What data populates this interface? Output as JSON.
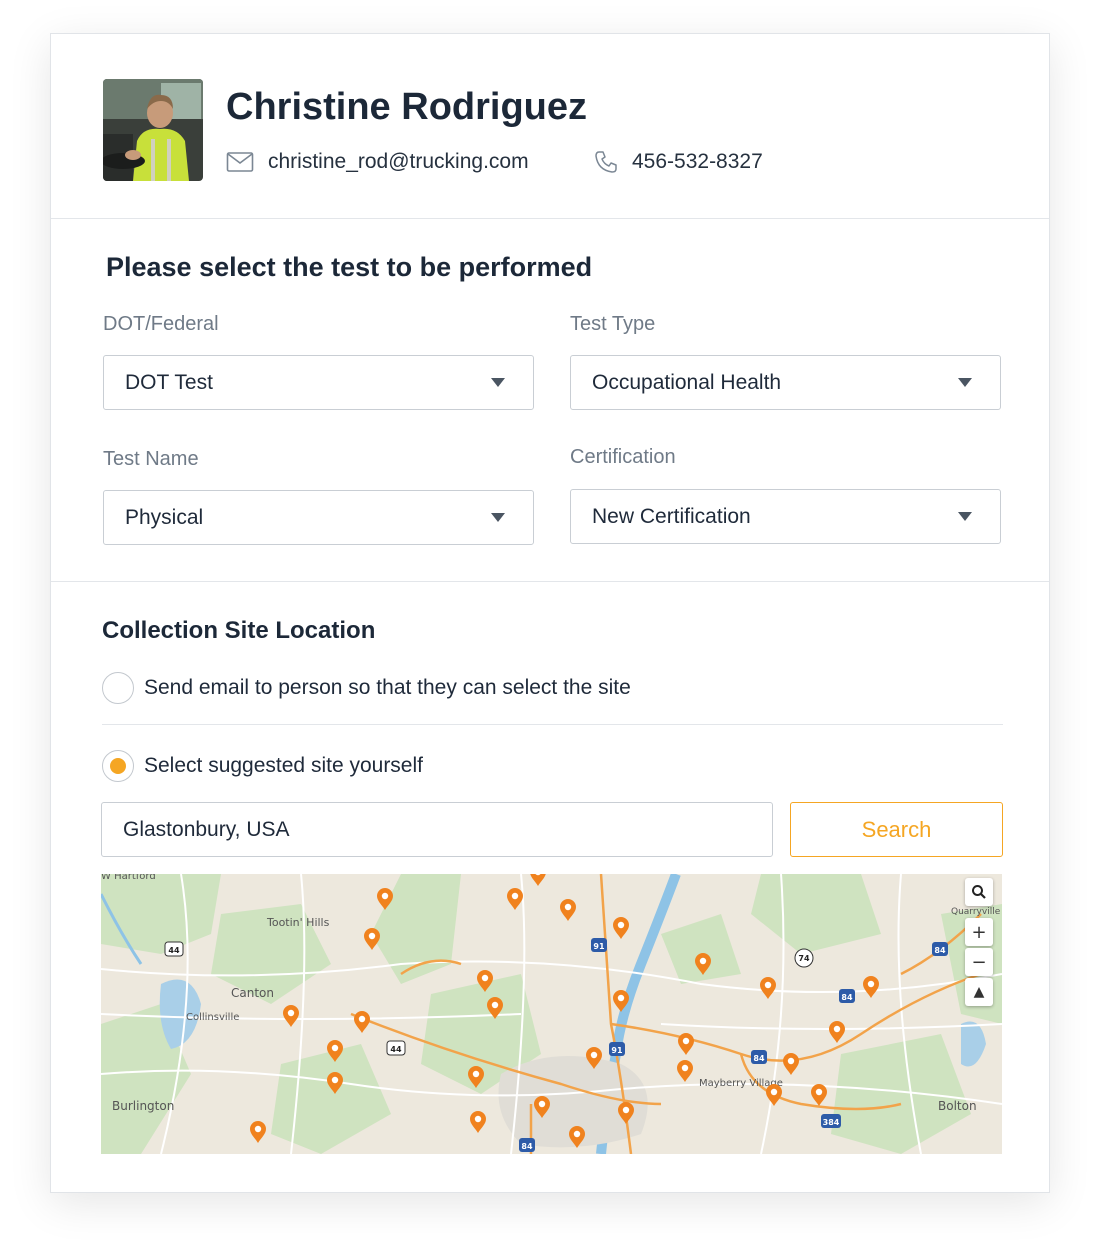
{
  "profile": {
    "name": "Christine Rodriguez",
    "email": "christine_rod@trucking.com",
    "phone": "456-532-8327"
  },
  "test_section": {
    "title": "Please select the test to be performed",
    "fields": [
      {
        "label": "DOT/Federal",
        "value": "DOT Test"
      },
      {
        "label": "Test Type",
        "value": "Occupational Health"
      },
      {
        "label": "Test Name",
        "value": "Physical"
      },
      {
        "label": "Certification",
        "value": "New Certification"
      }
    ]
  },
  "location_section": {
    "title": "Collection Site Location",
    "options": [
      {
        "label": "Send email to person so that they can select the site",
        "selected": false
      },
      {
        "label": "Select suggested site yourself",
        "selected": true
      }
    ],
    "search_value": "Glastonbury, USA",
    "search_button": "Search"
  },
  "map": {
    "places": [
      "Tootin' Hills",
      "Canton",
      "Collinsville",
      "Burlington",
      "Mayberry Village",
      "Bolton",
      "Quarryville",
      "W Hartford"
    ],
    "route_shields": [
      "44",
      "44",
      "91",
      "91",
      "74",
      "84",
      "84",
      "84",
      "384",
      "84"
    ],
    "controls": {
      "zoom_in": "+",
      "zoom_out": "−",
      "compass": "▲"
    },
    "pin_color": "#f0821e"
  },
  "colors": {
    "accent": "#f5a623",
    "heading": "#1c2838",
    "label": "#6f7a87"
  }
}
